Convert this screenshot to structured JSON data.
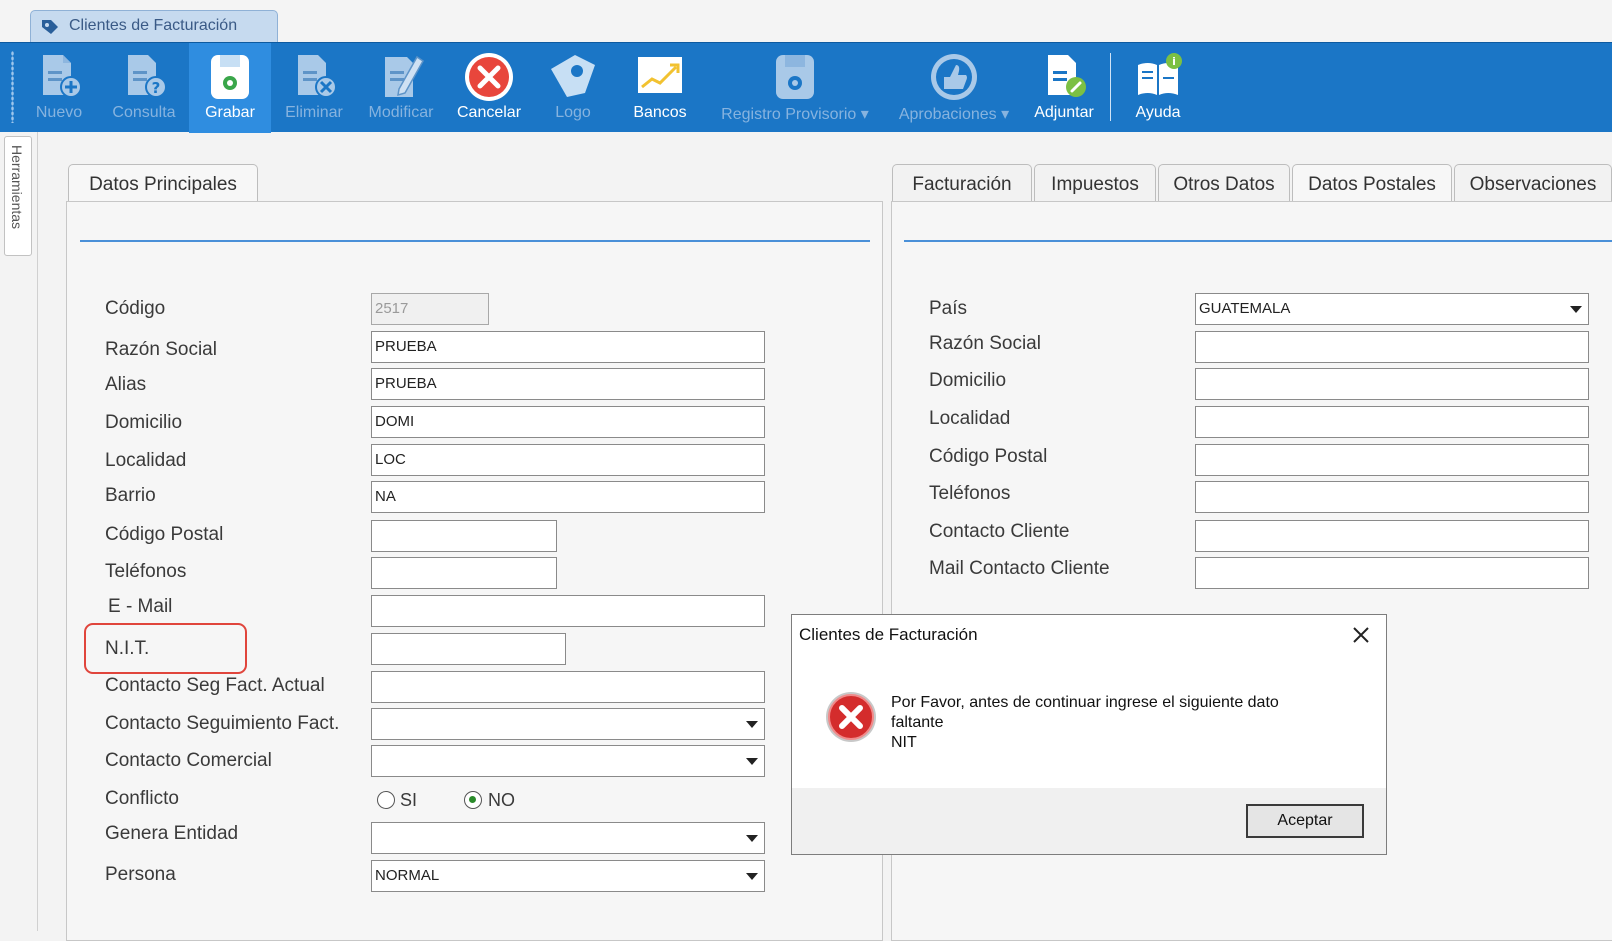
{
  "window_tab": {
    "title": "Clientes de Facturación"
  },
  "toolbar": {
    "buttons": [
      {
        "label": "Nuevo"
      },
      {
        "label": "Consulta"
      },
      {
        "label": "Grabar"
      },
      {
        "label": "Eliminar"
      },
      {
        "label": "Modificar"
      },
      {
        "label": "Cancelar"
      },
      {
        "label": "Logo"
      },
      {
        "label": "Bancos"
      },
      {
        "label": "Registro Provisorio ▾"
      },
      {
        "label": "Aprobaciones ▾"
      },
      {
        "label": "Adjuntar"
      },
      {
        "label": "Ayuda"
      }
    ]
  },
  "side_tab": {
    "label": "Herramientas"
  },
  "left_panel": {
    "tab": "Datos Principales",
    "fields": {
      "codigo": {
        "label": "Código",
        "value": "2517"
      },
      "razon_social": {
        "label": "Razón Social",
        "value": "PRUEBA"
      },
      "alias": {
        "label": "Alias",
        "value": "PRUEBA"
      },
      "domicilio": {
        "label": "Domicilio",
        "value": "DOMI"
      },
      "localidad": {
        "label": "Localidad",
        "value": "LOC"
      },
      "barrio": {
        "label": "Barrio",
        "value": "NA"
      },
      "codigo_postal": {
        "label": "Código Postal",
        "value": ""
      },
      "telefonos": {
        "label": "Teléfonos",
        "value": ""
      },
      "email": {
        "label": "E - Mail",
        "value": ""
      },
      "nit": {
        "label": "N.I.T.",
        "value": ""
      },
      "contacto_seg_actual": {
        "label": "Contacto Seg Fact. Actual",
        "value": ""
      },
      "contacto_seguimiento": {
        "label": "Contacto Seguimiento Fact.",
        "value": ""
      },
      "contacto_comercial": {
        "label": "Contacto Comercial",
        "value": ""
      },
      "conflicto": {
        "label": "Conflicto",
        "option_si": "SI",
        "option_no": "NO",
        "selected": "NO"
      },
      "genera_entidad": {
        "label": "Genera Entidad",
        "value": ""
      },
      "persona": {
        "label": "Persona",
        "value": "NORMAL"
      }
    }
  },
  "right_panel": {
    "tabs": [
      "Facturación",
      "Impuestos",
      "Otros Datos",
      "Datos Postales",
      "Observaciones"
    ],
    "selected_tab": "Datos Postales",
    "fields": {
      "pais": {
        "label": "País",
        "value": "GUATEMALA"
      },
      "razon_social": {
        "label": "Razón Social",
        "value": ""
      },
      "domicilio": {
        "label": "Domicilio",
        "value": ""
      },
      "localidad": {
        "label": "Localidad",
        "value": ""
      },
      "codigo_postal": {
        "label": "Código Postal",
        "value": ""
      },
      "telefonos": {
        "label": "Teléfonos",
        "value": ""
      },
      "contacto_cliente": {
        "label": "Contacto Cliente",
        "value": ""
      },
      "mail_contacto": {
        "label": "Mail Contacto Cliente",
        "value": ""
      }
    }
  },
  "dialog": {
    "title": "Clientes de Facturación",
    "message_line1": "Por Favor, antes de continuar ingrese el siguiente dato",
    "message_line2": "faltante",
    "message_line3": "NIT",
    "ok_label": "Aceptar",
    "icon": "error-icon"
  },
  "colors": {
    "toolbar_bg": "#1b76c6",
    "toolbar_active": "#2f8de0",
    "highlight": "#e0453c",
    "panel_line": "#4a90d8"
  }
}
